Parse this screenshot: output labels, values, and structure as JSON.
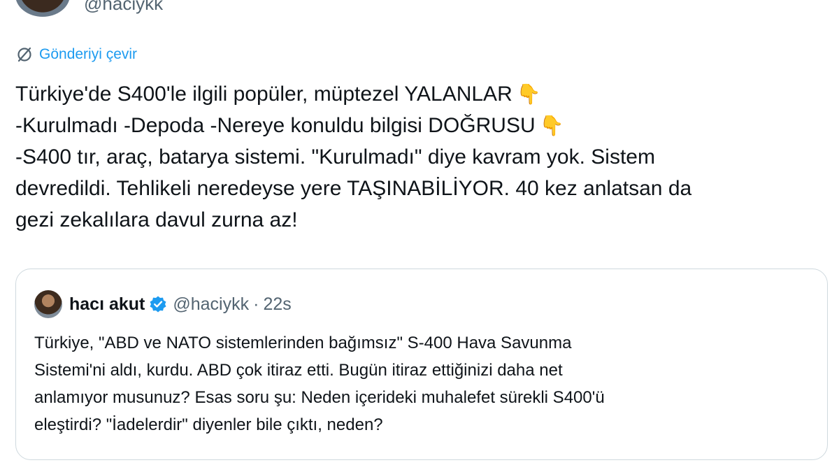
{
  "header": {
    "handle": "@haciykk"
  },
  "translate": {
    "label": "Gönderiyi çevir",
    "icon": "translate-icon"
  },
  "tweet": {
    "lines": [
      "Türkiye'de S400'le ilgili popüler, müptezel YALANLAR",
      "-Kurulmadı -Depoda -Nereye konuldu bilgisi DOĞRUSU",
      "-S400 tır, araç, batarya sistemi. \"Kurulmadı\" diye kavram yok. Sistem",
      "devredildi. Tehlikeli neredeyse yere TAŞINABİLİYOR. 40 kez anlatsan da",
      "gezi zekalılara davul zurna az!"
    ],
    "emoji": "👇"
  },
  "quote": {
    "name": "hacı akut",
    "handle": "@haciykk",
    "separator": "·",
    "time": "22s",
    "lines": [
      "Türkiye, \"ABD ve NATO sistemlerinden bağımsız\" S-400 Hava Savunma",
      "Sistemi'ni aldı, kurdu. ABD çok itiraz etti. Bugün itiraz ettiğinizi daha net",
      "anlamıyor musunuz? Esas soru şu: Neden içerideki muhalefet sürekli S400'ü",
      "eleştirdi? \"İadelerdir\" diyenler bile çıktı, neden?"
    ]
  },
  "colors": {
    "link": "#1d9bf0",
    "secondary_text": "#536471",
    "primary_text": "#0f1419",
    "border": "#cfd9de",
    "verified": "#1d9bf0"
  }
}
